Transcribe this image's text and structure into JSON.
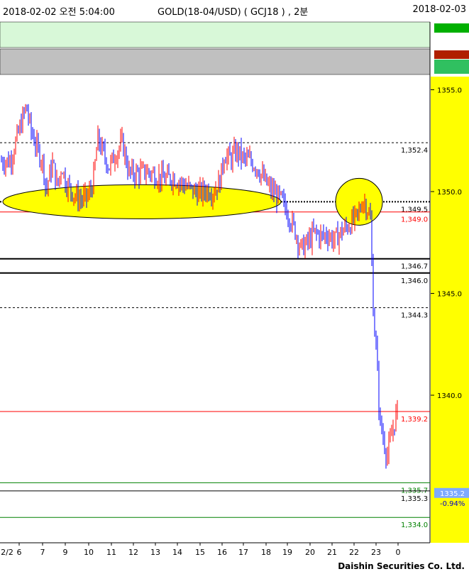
{
  "header": {
    "datetime": "2018-02-02 오전 5:04:00",
    "symbol": "GOLD(18-04/USD)  ( GCJ18 ) ,  2분",
    "end_date": "2018-02-03"
  },
  "footer": {
    "brand": "Daishin Securities Co. Ltd."
  },
  "colors": {
    "up_candle": "#ff0000",
    "down_candle": "#0000ff",
    "panel_green": "#d8f8d8",
    "panel_gray": "#c0c0c0",
    "axis_yellow": "#ffff00",
    "highlight_ellipse": "#ffff00",
    "current_price_badge": "#7eaaff"
  },
  "chart_data": {
    "type": "candlestick",
    "ylim": [
      1331.5,
      1357.0
    ],
    "y_ticks": [
      1355.0,
      1350.0,
      1345.0,
      1340.0
    ],
    "y_tick_labels": [
      "1355.0",
      "1350.0",
      "1345.0",
      "1340.0"
    ],
    "x_tick_labels": [
      "2/2",
      "6",
      "7",
      "9",
      "10",
      "11",
      "12",
      "13",
      "14",
      "15",
      "16",
      "17",
      "18",
      "19",
      "20",
      "21",
      "22",
      "23",
      "0"
    ],
    "x_tick_hours": [
      null,
      6,
      7,
      9,
      10,
      11,
      12,
      13,
      14,
      15,
      16,
      17,
      18,
      19,
      20,
      21,
      22,
      23,
      0
    ],
    "levels": [
      {
        "value": 1352.4,
        "label": "1,352.4",
        "style": "dashed",
        "color": "#000000"
      },
      {
        "value": 1349.5,
        "label": "1,349.5",
        "style": "dotted",
        "color": "#000000"
      },
      {
        "value": 1349.0,
        "label": "1,349.0",
        "style": "solid",
        "color": "#ff0000"
      },
      {
        "value": 1346.7,
        "label": "1,346.7",
        "style": "solid-bold",
        "color": "#000000"
      },
      {
        "value": 1346.0,
        "label": "1,346.0",
        "style": "solid-bold",
        "color": "#000000"
      },
      {
        "value": 1344.3,
        "label": "1,344.3",
        "style": "dashed",
        "color": "#000000"
      },
      {
        "value": 1339.2,
        "label": "1,339.2",
        "style": "solid",
        "color": "#ff0000"
      },
      {
        "value": 1335.7,
        "label": "1,335.7",
        "style": "solid",
        "color": "#008000"
      },
      {
        "value": 1335.3,
        "label": "1,335.3",
        "style": "solid",
        "color": "#000000"
      },
      {
        "value": 1334.0,
        "label": "1,334.0",
        "style": "solid",
        "color": "#008000"
      }
    ],
    "current": {
      "value": 1335.2,
      "label": "1335.2",
      "change": "-0.94%"
    },
    "series_path": [
      [
        5.6,
        1351.5
      ],
      [
        6.0,
        1353.0
      ],
      [
        6.3,
        1354.2
      ],
      [
        6.5,
        1353.0
      ],
      [
        6.8,
        1352.0
      ],
      [
        7.1,
        1351.2
      ],
      [
        7.3,
        1350.0
      ],
      [
        7.6,
        1350.8
      ],
      [
        7.9,
        1351.4
      ],
      [
        8.3,
        1350.2
      ],
      [
        8.7,
        1351.3
      ],
      [
        9.0,
        1350.5
      ],
      [
        9.4,
        1349.8
      ],
      [
        9.7,
        1349.6
      ],
      [
        10.0,
        1349.8
      ],
      [
        10.2,
        1350.5
      ],
      [
        10.4,
        1352.6
      ],
      [
        10.6,
        1352.0
      ],
      [
        10.9,
        1351.2
      ],
      [
        11.2,
        1351.9
      ],
      [
        11.5,
        1352.4
      ],
      [
        11.8,
        1350.9
      ],
      [
        12.2,
        1350.9
      ],
      [
        12.6,
        1351.0
      ],
      [
        13.0,
        1350.8
      ],
      [
        13.4,
        1350.6
      ],
      [
        13.8,
        1350.7
      ],
      [
        14.2,
        1350.4
      ],
      [
        14.6,
        1350.1
      ],
      [
        15.0,
        1349.9
      ],
      [
        15.3,
        1350.1
      ],
      [
        15.6,
        1350.0
      ],
      [
        15.9,
        1350.5
      ],
      [
        16.1,
        1351.8
      ],
      [
        16.4,
        1351.6
      ],
      [
        16.7,
        1352.0
      ],
      [
        17.0,
        1351.6
      ],
      [
        17.3,
        1351.5
      ],
      [
        17.6,
        1351.2
      ],
      [
        17.9,
        1350.6
      ],
      [
        18.2,
        1350.1
      ],
      [
        18.5,
        1349.8
      ],
      [
        18.7,
        1349.6
      ],
      [
        19.0,
        1349.0
      ],
      [
        19.3,
        1348.2
      ],
      [
        19.6,
        1347.2
      ],
      [
        19.9,
        1347.5
      ],
      [
        20.2,
        1348.0
      ],
      [
        20.5,
        1347.8
      ],
      [
        20.8,
        1347.9
      ],
      [
        21.1,
        1347.6
      ],
      [
        21.4,
        1348.0
      ],
      [
        21.7,
        1348.3
      ],
      [
        22.0,
        1348.6
      ],
      [
        22.2,
        1348.9
      ],
      [
        22.4,
        1349.6
      ],
      [
        22.6,
        1349.2
      ],
      [
        22.75,
        1348.5
      ],
      [
        22.85,
        1345.0
      ],
      [
        22.9,
        1343.5
      ],
      [
        23.0,
        1342.5
      ],
      [
        23.1,
        1340.0
      ],
      [
        23.2,
        1338.5
      ],
      [
        23.35,
        1337.8
      ],
      [
        23.5,
        1337.0
      ],
      [
        23.7,
        1338.0
      ],
      [
        23.9,
        1339.0
      ],
      [
        24.05,
        1339.5
      ],
      [
        24.2,
        1338.5
      ],
      [
        24.3,
        1337.5
      ],
      [
        24.4,
        1335.6
      ],
      [
        24.5,
        1335.2
      ]
    ]
  }
}
